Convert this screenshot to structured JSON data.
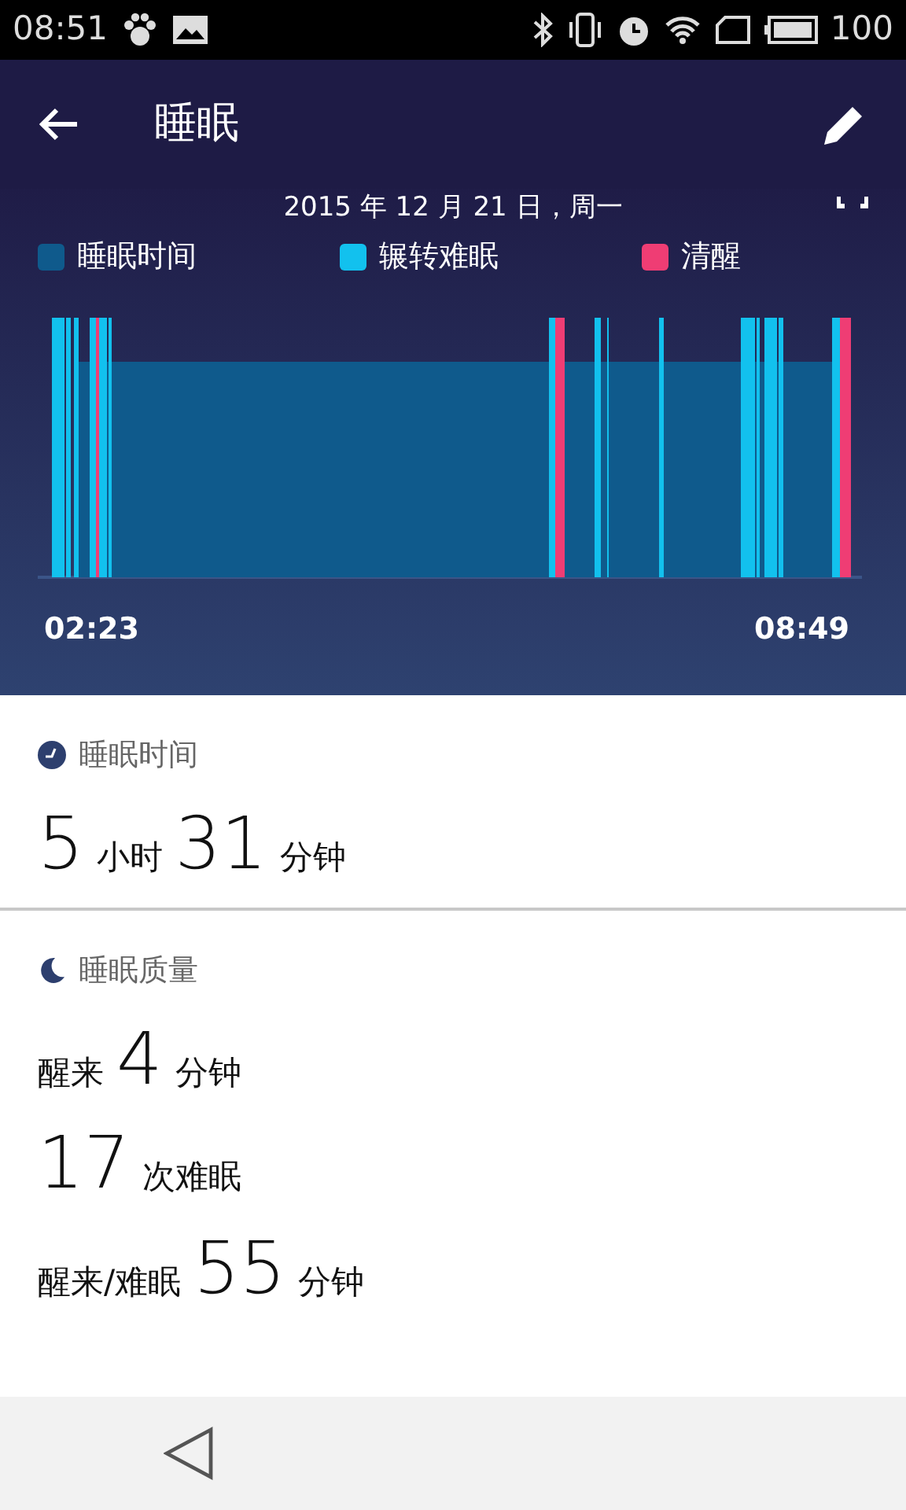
{
  "status_bar": {
    "time": "08:51",
    "battery": "100"
  },
  "app_bar": {
    "title": "睡眠"
  },
  "date": "2015 年 12 月 21 日，周一",
  "legend": [
    {
      "label": "睡眠时间",
      "color": "#0f5a8c"
    },
    {
      "label": "辗转难眠",
      "color": "#12c1ee"
    },
    {
      "label": "清醒",
      "color": "#ef3d74"
    }
  ],
  "chart_start": "02:23",
  "chart_end": "08:49",
  "sections": [
    {
      "kind": "duration",
      "title": "睡眠时间",
      "lines": [
        [
          {
            "kind": "number",
            "text": "5"
          },
          {
            "kind": "unit",
            "text": "小时"
          },
          {
            "kind": "number",
            "text": "31"
          },
          {
            "kind": "unit",
            "text": "分钟"
          }
        ]
      ]
    },
    {
      "kind": "quality",
      "title": "睡眠质量",
      "lines": [
        [
          {
            "kind": "unit",
            "text": "醒来"
          },
          {
            "kind": "number",
            "text": "4"
          },
          {
            "kind": "unit",
            "text": "分钟"
          }
        ],
        [
          {
            "kind": "number",
            "text": "17"
          },
          {
            "kind": "unit",
            "text": "次难眠"
          }
        ],
        [
          {
            "kind": "unit",
            "text": "醒来/难眠"
          },
          {
            "kind": "number",
            "text": "55"
          },
          {
            "kind": "unit",
            "text": "分钟"
          }
        ]
      ]
    }
  ]
}
